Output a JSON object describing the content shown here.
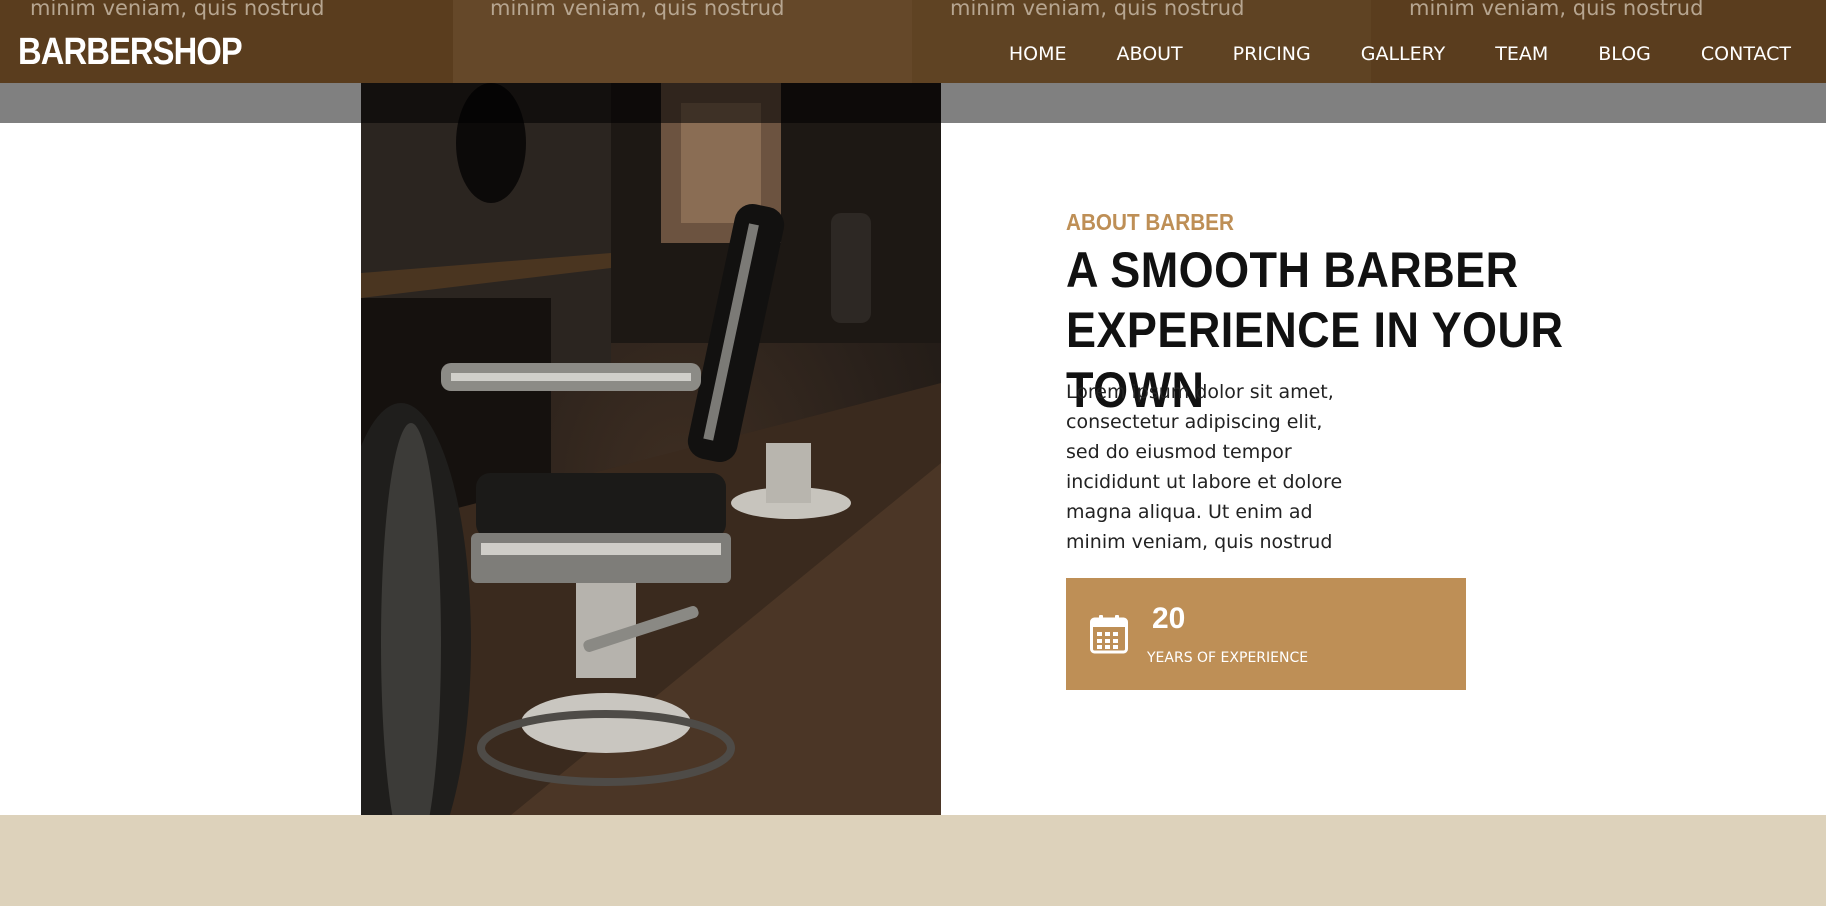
{
  "header": {
    "logo": "BARBERSHOP",
    "ghost_text": "minim veniam, quis nostrud",
    "nav": [
      "HOME",
      "ABOUT",
      "PRICING",
      "GALLERY",
      "TEAM",
      "BLOG",
      "CONTACT"
    ]
  },
  "about": {
    "label": "ABOUT BARBER",
    "headline_line1": "A SMOOTH BARBER",
    "headline_line2": "EXPERIENCE IN YOUR TOWN",
    "body_lines": [
      "Lorem ipsum dolor sit amet,",
      "consectetur adipiscing elit,",
      "sed do eiusmod tempor",
      "incididunt ut labore et dolore",
      "magna aliqua. Ut enim ad",
      "minim veniam, quis nostrud"
    ],
    "experience": {
      "number": "20",
      "label": "YEARS OF EXPERIENCE",
      "icon": "calendar-icon"
    }
  },
  "colors": {
    "header_bg": "#5a3d1e",
    "accent": "#be8f56",
    "footer_band": "#ddd2bb",
    "heading": "#111111"
  }
}
